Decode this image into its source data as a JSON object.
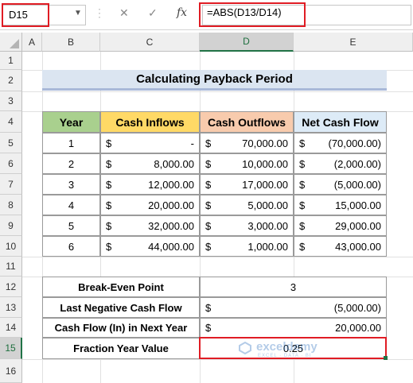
{
  "formula_bar": {
    "cell_ref": "D15",
    "formula": "=ABS(D13/D14)",
    "fx_symbol": "fx"
  },
  "columns": [
    "A",
    "B",
    "C",
    "D",
    "E"
  ],
  "rows": [
    "1",
    "2",
    "3",
    "4",
    "5",
    "6",
    "7",
    "8",
    "9",
    "10",
    "11",
    "12",
    "13",
    "14",
    "15",
    "16"
  ],
  "title": "Calculating Payback Period",
  "table": {
    "headers": [
      "Year",
      "Cash Inflows",
      "Cash Outflows",
      "Net Cash Flow"
    ],
    "header_colors": [
      "#a9d08e",
      "#ffd966",
      "#f8cbad",
      "#ddebf7"
    ],
    "rows": [
      {
        "year": "1",
        "inflow_sym": "$",
        "inflow": "-",
        "outflow_sym": "$",
        "outflow": "70,000.00",
        "net_sym": "$",
        "net": "(70,000.00)"
      },
      {
        "year": "2",
        "inflow_sym": "$",
        "inflow": "8,000.00",
        "outflow_sym": "$",
        "outflow": "10,000.00",
        "net_sym": "$",
        "net": "(2,000.00)"
      },
      {
        "year": "3",
        "inflow_sym": "$",
        "inflow": "12,000.00",
        "outflow_sym": "$",
        "outflow": "17,000.00",
        "net_sym": "$",
        "net": "(5,000.00)"
      },
      {
        "year": "4",
        "inflow_sym": "$",
        "inflow": "20,000.00",
        "outflow_sym": "$",
        "outflow": "5,000.00",
        "net_sym": "$",
        "net": "15,000.00"
      },
      {
        "year": "5",
        "inflow_sym": "$",
        "inflow": "32,000.00",
        "outflow_sym": "$",
        "outflow": "3,000.00",
        "net_sym": "$",
        "net": "29,000.00"
      },
      {
        "year": "6",
        "inflow_sym": "$",
        "inflow": "44,000.00",
        "outflow_sym": "$",
        "outflow": "1,000.00",
        "net_sym": "$",
        "net": "43,000.00"
      }
    ]
  },
  "summary": [
    {
      "label": "Break-Even Point",
      "sym": "",
      "value": "3"
    },
    {
      "label": "Last Negative Cash Flow",
      "sym": "$",
      "value": "(5,000.00)"
    },
    {
      "label": "Cash Flow (In) in Next Year",
      "sym": "$",
      "value": "20,000.00"
    },
    {
      "label": "Fraction Year Value",
      "sym": "",
      "value": "0.25"
    }
  ],
  "watermark": {
    "name": "exceldemy",
    "tagline": "EXCEL · DATA · BI"
  },
  "colors": {
    "accent_red": "#e01c24",
    "excel_green": "#217346"
  }
}
